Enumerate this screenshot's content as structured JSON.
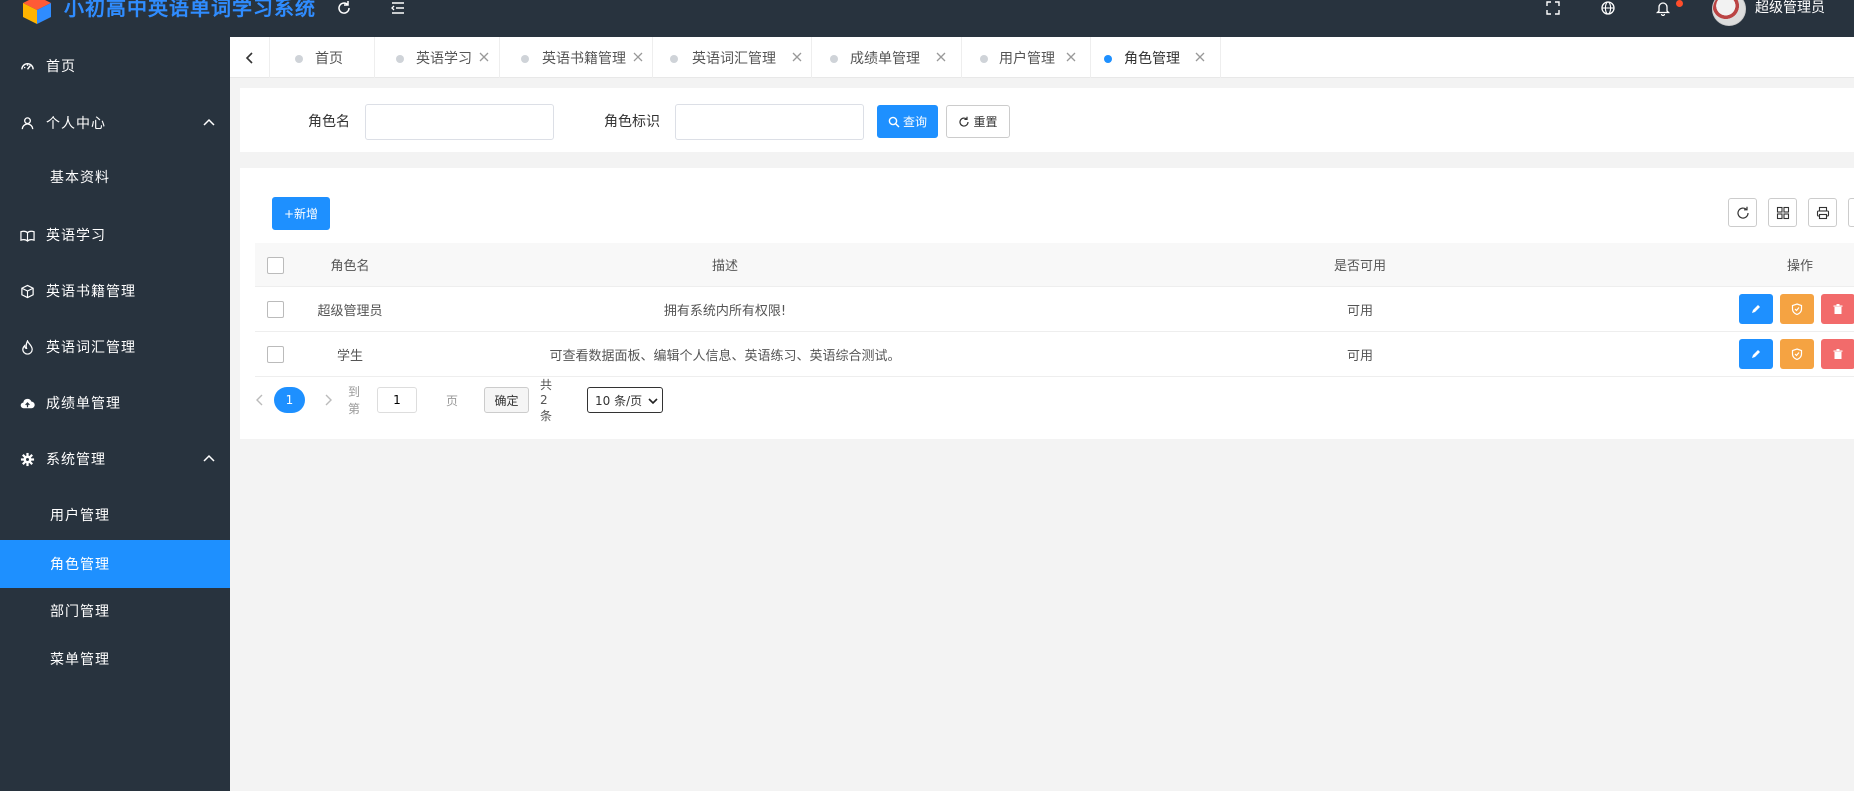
{
  "app": {
    "title": "小初高中英语单词学习系统",
    "user_name": "超级管理员"
  },
  "header_icons": [
    "refresh-icon",
    "menu-fold-icon",
    "fullscreen-icon",
    "globe-icon",
    "bell-icon"
  ],
  "sidebar": {
    "items": [
      {
        "label": "首页",
        "icon": "dashboard-icon"
      },
      {
        "label": "个人中心",
        "icon": "user-icon",
        "expanded": true
      },
      {
        "label": "基本资料",
        "sub": true
      },
      {
        "label": "英语学习",
        "icon": "book-icon"
      },
      {
        "label": "英语书籍管理",
        "icon": "cube-icon"
      },
      {
        "label": "英语词汇管理",
        "icon": "fire-icon"
      },
      {
        "label": "成绩单管理",
        "icon": "cloud-upload-icon"
      },
      {
        "label": "系统管理",
        "icon": "gear-icon",
        "expanded": true
      },
      {
        "label": "用户管理",
        "sub": true
      },
      {
        "label": "角色管理",
        "sub": true,
        "active": true
      },
      {
        "label": "部门管理",
        "sub": true
      },
      {
        "label": "菜单管理",
        "sub": true
      }
    ]
  },
  "tabs": [
    {
      "label": "首页"
    },
    {
      "label": "英语学习"
    },
    {
      "label": "英语书籍管理"
    },
    {
      "label": "英语词汇管理"
    },
    {
      "label": "成绩单管理"
    },
    {
      "label": "用户管理"
    },
    {
      "label": "角色管理",
      "active": true
    }
  ],
  "search": {
    "role_name_label": "角色名",
    "role_name_value": "",
    "role_key_label": "角色标识",
    "role_key_value": "",
    "query_label": "查询",
    "reset_label": "重置"
  },
  "table": {
    "add_label": "+新增",
    "columns": [
      "角色名",
      "描述",
      "是否可用",
      "操作"
    ],
    "rows": [
      {
        "name": "超级管理员",
        "desc": "拥有系统内所有权限!",
        "enabled": "可用"
      },
      {
        "name": "学生",
        "desc": "可查看数据面板、编辑个人信息、英语练习、英语综合测试。",
        "enabled": "可用"
      }
    ]
  },
  "pagination": {
    "current_page": "1",
    "goto_label": "到第",
    "goto_value": "1",
    "page_unit": "页",
    "confirm_label": "确定",
    "total_label": "共 2 条",
    "page_size": "10 条/页"
  },
  "colors": {
    "accent": "#1e90ff",
    "sidebar_bg": "#28333e",
    "edit": "#1e90ff",
    "permission": "#f5a342",
    "delete": "#f26b6b"
  }
}
